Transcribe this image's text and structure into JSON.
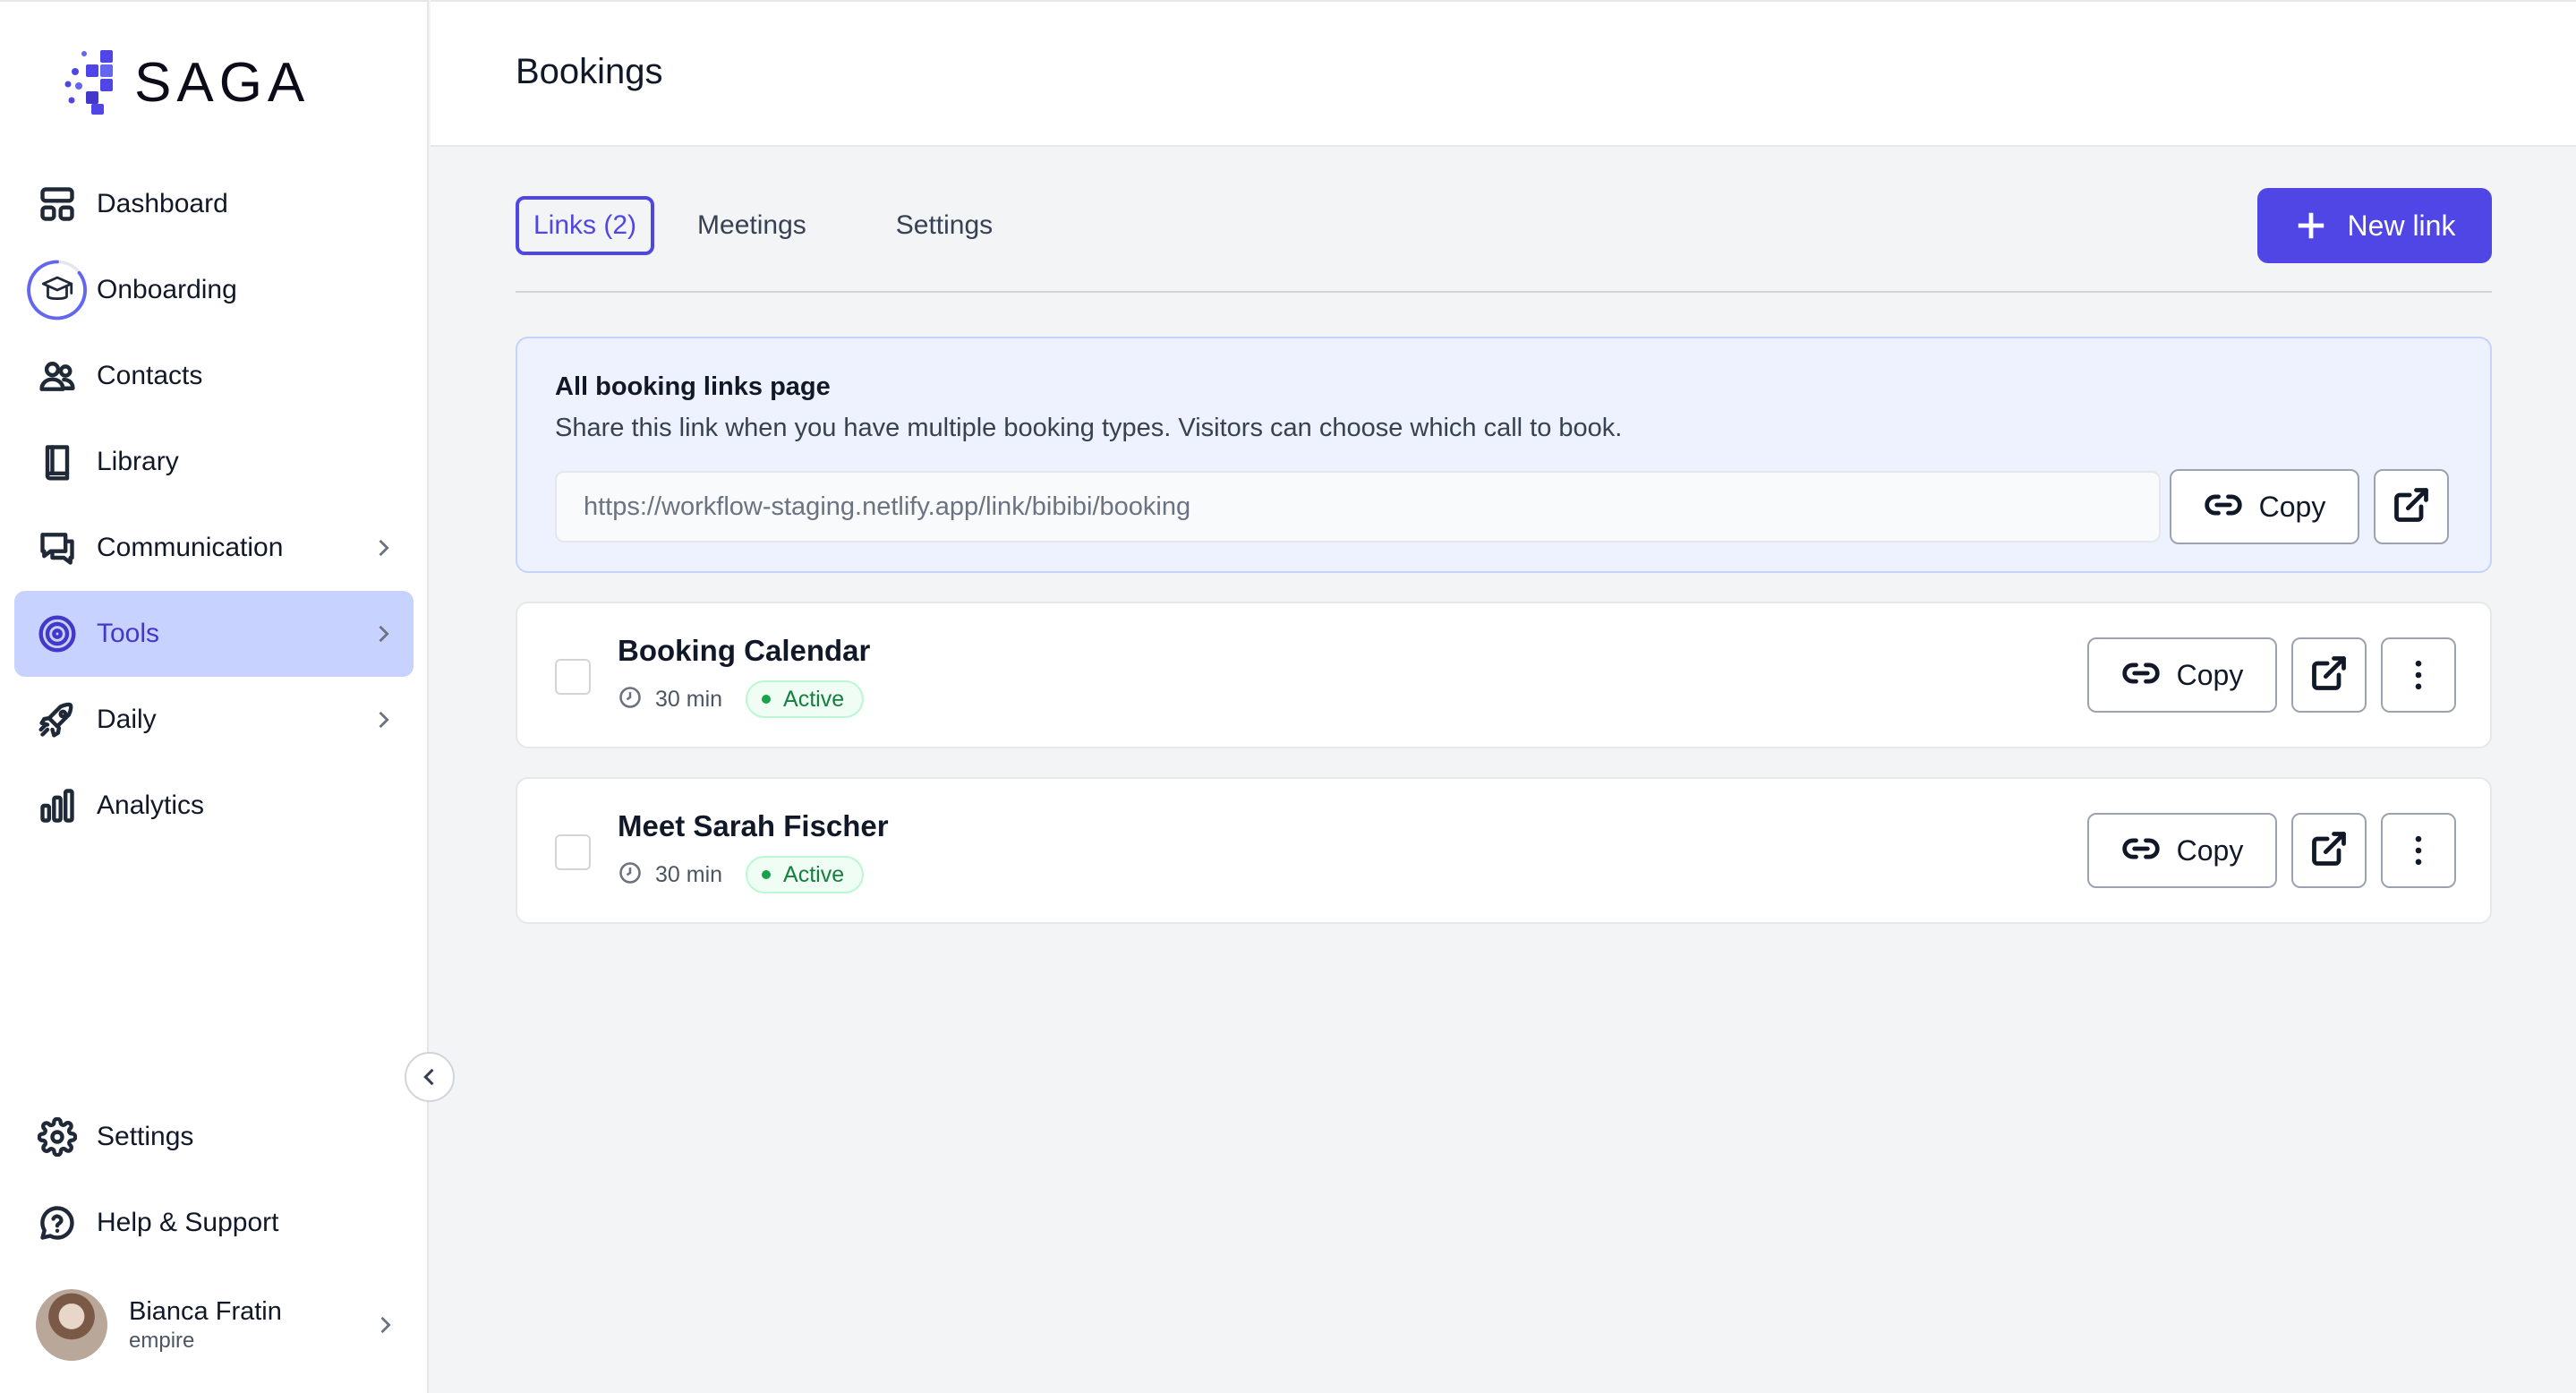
{
  "brand": {
    "name": "SAGA",
    "accent": "#4f46e5"
  },
  "sidebar": {
    "items": [
      {
        "label": "Dashboard",
        "icon": "dashboard-icon"
      },
      {
        "label": "Onboarding",
        "icon": "graduation-cap-icon"
      },
      {
        "label": "Contacts",
        "icon": "users-icon"
      },
      {
        "label": "Library",
        "icon": "book-icon"
      },
      {
        "label": "Communication",
        "icon": "chat-icon",
        "has_submenu": true
      },
      {
        "label": "Tools",
        "icon": "target-icon",
        "has_submenu": true,
        "active": true
      },
      {
        "label": "Daily",
        "icon": "rocket-icon",
        "has_submenu": true
      },
      {
        "label": "Analytics",
        "icon": "bar-chart-icon"
      }
    ],
    "bottom_items": [
      {
        "label": "Settings",
        "icon": "gear-icon"
      },
      {
        "label": "Help & Support",
        "icon": "help-chat-icon"
      }
    ],
    "user": {
      "name": "Bianca Fratin",
      "org": "empire"
    }
  },
  "header": {
    "title": "Bookings"
  },
  "tabs": [
    {
      "label": "Links (2)",
      "active": true
    },
    {
      "label": "Meetings"
    },
    {
      "label": "Settings"
    }
  ],
  "new_link_label": "New link",
  "all_links": {
    "title": "All booking links page",
    "description": "Share this link when you have multiple booking types. Visitors can choose which call to book.",
    "url": "https://workflow-staging.netlify.app/link/bibibi/booking",
    "copy_label": "Copy"
  },
  "links": [
    {
      "name": "Booking Calendar",
      "duration": "30 min",
      "status": "Active",
      "copy_label": "Copy"
    },
    {
      "name": "Meet Sarah Fischer",
      "duration": "30 min",
      "status": "Active",
      "copy_label": "Copy"
    }
  ]
}
